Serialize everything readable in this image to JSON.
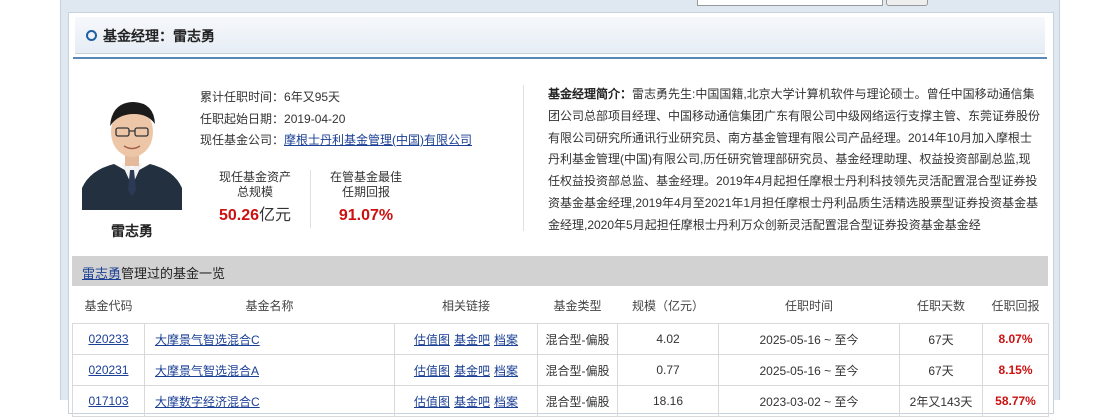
{
  "header": {
    "title": "基金经理：雷志勇"
  },
  "manager": {
    "name": "雷志勇",
    "tenure_label": "累计任职时间：",
    "tenure_value": "6年又95天",
    "start_label": "任职起始日期：",
    "start_value": "2019-04-20",
    "company_label": "现任基金公司：",
    "company_value": "摩根士丹利基金管理(中国)有限公司",
    "assets_label_1": "现任基金资产",
    "assets_label_2": "总规模",
    "assets_value": "50.26",
    "assets_unit": "亿元",
    "best_label_1": "在管基金最佳",
    "best_label_2": "任期回报",
    "best_value": "91.07%"
  },
  "bio": {
    "label": "基金经理简介：",
    "text": "雷志勇先生:中国国籍,北京大学计算机软件与理论硕士。曾任中国移动通信集团公司总部项目经理、中国移动通信集团广东有限公司中级网络运行支撑主管、东莞证券股份有限公司研究所通讯行业研究员、南方基金管理有限公司产品经理。2014年10月加入摩根士丹利基金管理(中国)有限公司,历任研究管理部研究员、基金经理助理、权益投资部副总监,现任权益投资部总监、基金经理。2019年4月起担任摩根士丹利科技领先灵活配置混合型证券投资基金基金经理,2019年4月至2021年1月担任摩根士丹利品质生活精选股票型证券投资基金基金经理,2020年5月起担任摩根士丹利万众创新灵活配置混合型证券投资基金基金经"
  },
  "list": {
    "name_link": "雷志勇",
    "title_suffix": "管理过的基金一览",
    "columns": [
      "基金代码",
      "基金名称",
      "相关链接",
      "基金类型",
      "规模（亿元）",
      "任职时间",
      "任职天数",
      "任职回报"
    ],
    "link_labels": [
      "估值图",
      "基金吧",
      "档案"
    ],
    "rows": [
      {
        "code": "020233",
        "name": "大摩景气智选混合C",
        "type": "混合型-偏股",
        "size": "4.02",
        "period": "2025-05-16 ~ 至今",
        "days": "67天",
        "ret": "8.07%"
      },
      {
        "code": "020231",
        "name": "大摩景气智选混合A",
        "type": "混合型-偏股",
        "size": "0.77",
        "period": "2025-05-16 ~ 至今",
        "days": "67天",
        "ret": "8.15%"
      },
      {
        "code": "017103",
        "name": "大摩数字经济混合C",
        "type": "混合型-偏股",
        "size": "18.16",
        "period": "2023-03-02 ~ 至今",
        "days": "2年又143天",
        "ret": "58.77%"
      }
    ]
  }
}
